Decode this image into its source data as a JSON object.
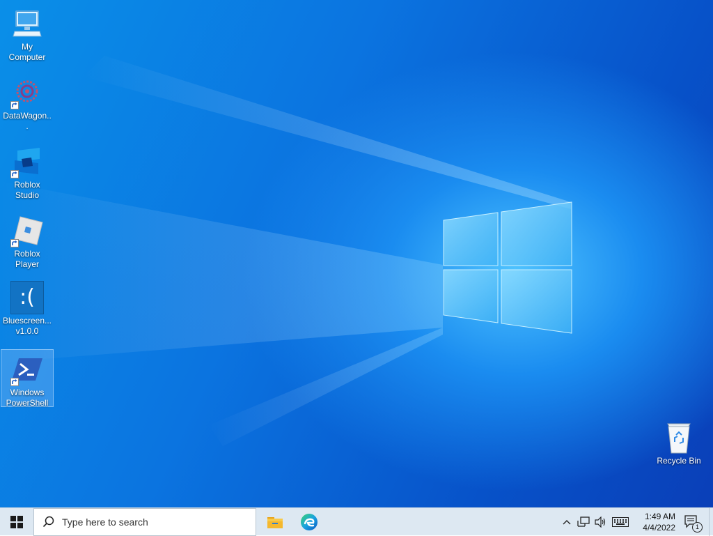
{
  "desktop": {
    "icons": [
      {
        "label": "My Computer"
      },
      {
        "label": "DataWagon..."
      },
      {
        "label": "Roblox Studio"
      },
      {
        "label": "Roblox Player"
      },
      {
        "label": "Bluescreen... v1.0.0",
        "glyph_text": ":("
      },
      {
        "label": "Windows PowerShell"
      },
      {
        "label": "Recycle Bin"
      }
    ]
  },
  "taskbar": {
    "search_placeholder": "Type here to search",
    "time": "1:49 AM",
    "date": "4/4/2022",
    "notification_count": "1"
  },
  "colors": {
    "wallpaper_accent": "#0b74e0",
    "taskbar_bg": "#dde8f2"
  }
}
